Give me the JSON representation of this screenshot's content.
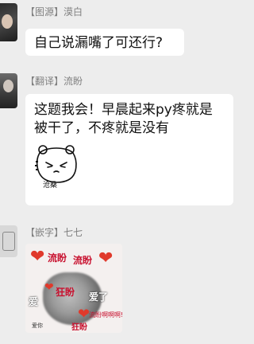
{
  "messages": [
    {
      "sender": "【图源】漠白",
      "text": "自己说漏嘴了可还行?"
    },
    {
      "sender": "【翻译】流盼",
      "text": "这题我会！早晨起来py疼就是被干了，不疼就是没有",
      "sticker_caption": "沧桑"
    },
    {
      "sender": "【嵌字】七七",
      "sticker_labels": {
        "top_left": "流盼",
        "top_right": "流盼",
        "mid": "狂盼",
        "mid_right": "爱了",
        "left": "爱",
        "bottom": "狂盼",
        "bottom_left": "爱你",
        "bottom_right": "流盼啊啊啊!"
      }
    }
  ],
  "colors": {
    "background": "#ededed",
    "bubble": "#ffffff",
    "sender_name": "#808080",
    "heart": "#e0392b"
  }
}
